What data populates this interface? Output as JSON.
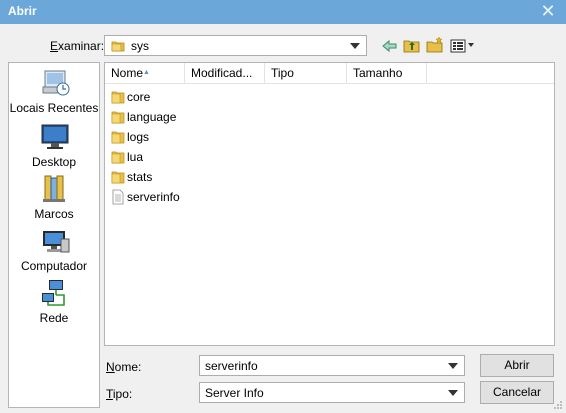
{
  "window": {
    "title": "Abrir"
  },
  "lookin": {
    "label_prefix": "E",
    "label_rest": "xaminar:",
    "value": "sys"
  },
  "toolbar": {
    "back_icon": "back-arrow-icon",
    "up_icon": "up-folder-icon",
    "new_folder_icon": "new-folder-icon",
    "views_icon": "views-menu-icon"
  },
  "places": [
    {
      "label": "Locais Recentes",
      "icon": "recent-places-icon"
    },
    {
      "label": "Desktop",
      "icon": "desktop-icon"
    },
    {
      "label": "Marcos",
      "icon": "libraries-icon"
    },
    {
      "label": "Computador",
      "icon": "computer-icon"
    },
    {
      "label": "Rede",
      "icon": "network-icon"
    }
  ],
  "columns": [
    "Nome",
    "Modificad...",
    "Tipo",
    "Tamanho"
  ],
  "files": [
    {
      "name": "core",
      "type": "folder"
    },
    {
      "name": "language",
      "type": "folder"
    },
    {
      "name": "logs",
      "type": "folder"
    },
    {
      "name": "lua",
      "type": "folder"
    },
    {
      "name": "stats",
      "type": "folder"
    },
    {
      "name": "serverinfo",
      "type": "file"
    }
  ],
  "filename": {
    "label_prefix": "N",
    "label_rest": "ome:",
    "value": "serverinfo"
  },
  "filetype": {
    "label_prefix": "T",
    "label_rest": "ipo:",
    "value": "Server Info"
  },
  "buttons": {
    "open": "Abrir",
    "cancel": "Cancelar"
  },
  "colors": {
    "titlebar": "#6ba7d9",
    "folder": "#e8c048",
    "window_bg": "#f0f0f0"
  }
}
